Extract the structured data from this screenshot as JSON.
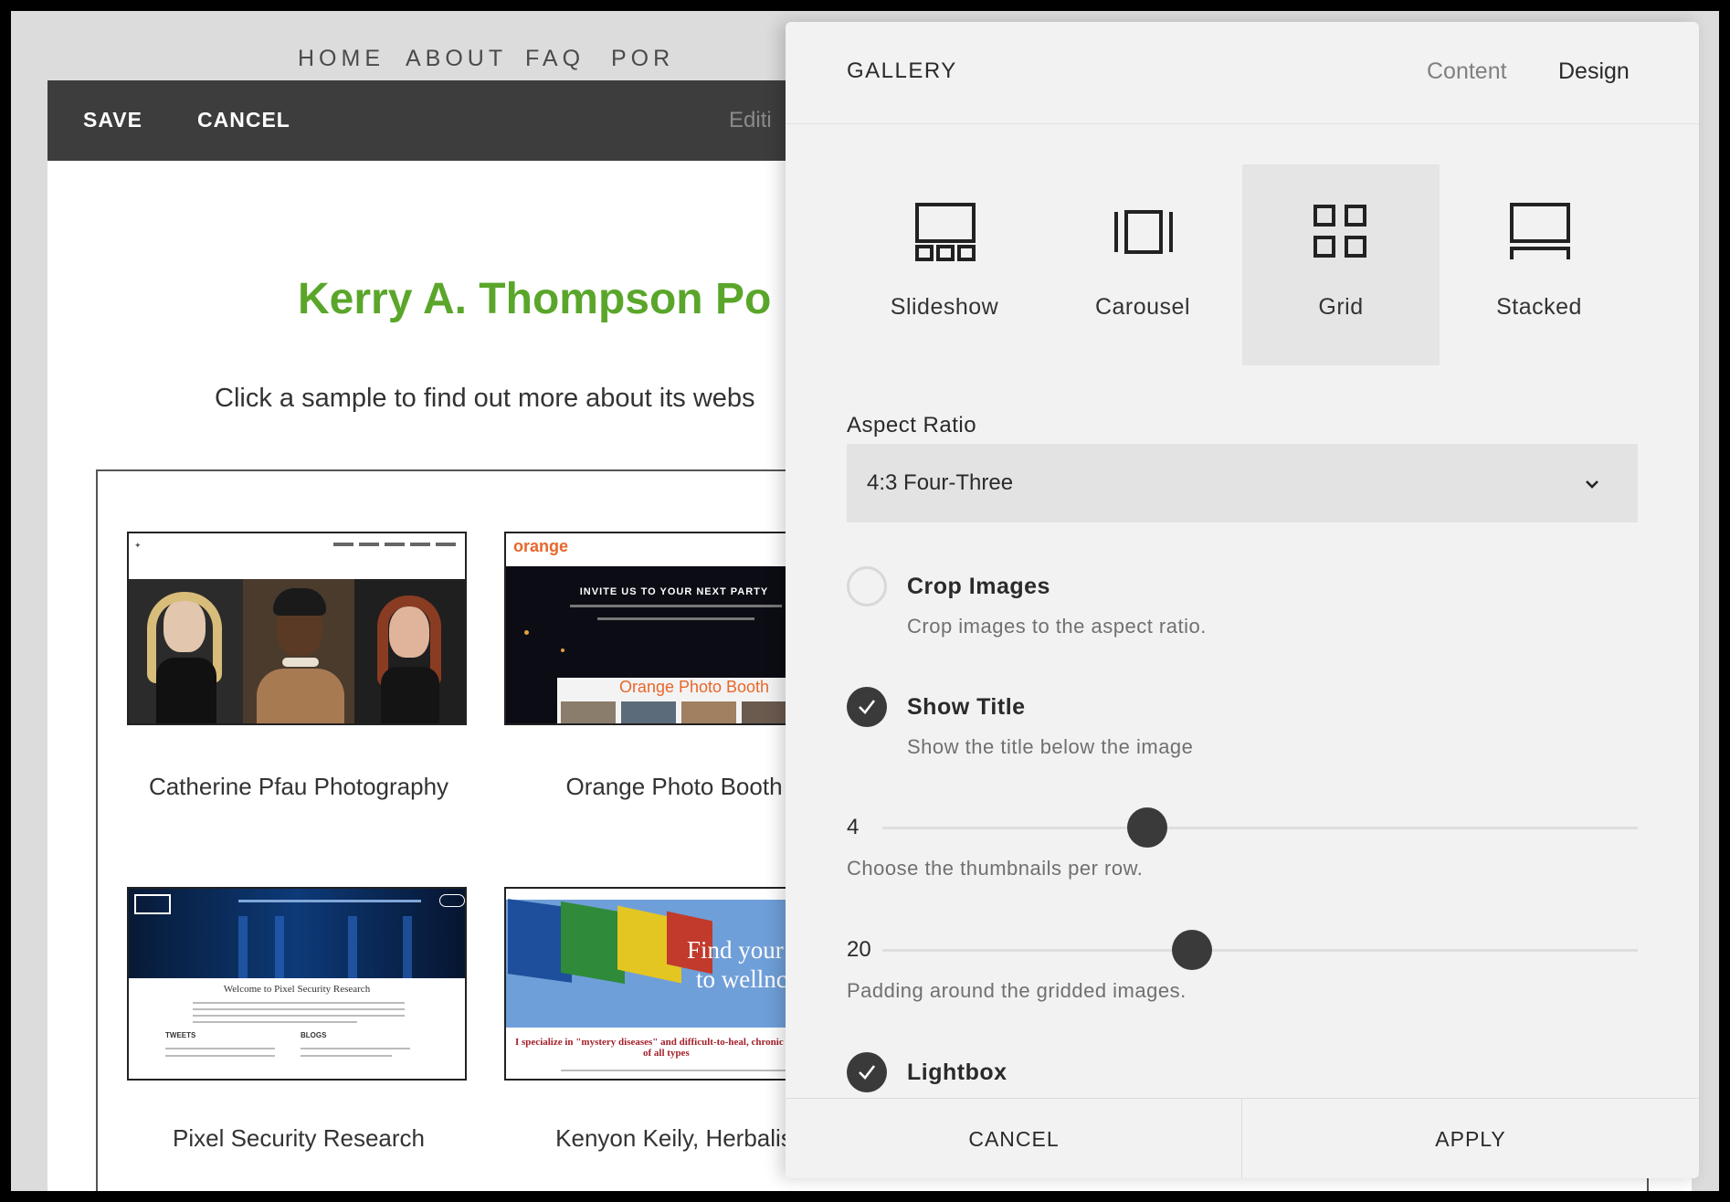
{
  "top_nav": [
    "HOME",
    "ABOUT",
    "FAQ",
    "POR"
  ],
  "edit_bar": {
    "save_label": "SAVE",
    "cancel_label": "CANCEL",
    "status_text": "Editi"
  },
  "page": {
    "title": "Kerry A. Thompson Po",
    "subtitle": "Click a sample to find out more about its webs"
  },
  "gallery_items": [
    {
      "caption": "Catherine Pfau Photography"
    },
    {
      "caption": "Orange Photo Booth",
      "thumb_text": [
        "INVITE US TO YOUR NEXT PARTY",
        "Orange Photo Booth",
        "orange"
      ]
    },
    {
      "caption": "Pixel Security Research",
      "thumb_text": [
        "Welcome to Pixel Security Research",
        "TWEETS",
        "BLOGS"
      ]
    },
    {
      "caption": "Kenyon Keily, Herbalis",
      "thumb_text": [
        "Find your",
        "to wellnc",
        "I specialize in \"mystery diseases\" and difficult-to-heal, chronic co",
        "of all types"
      ]
    }
  ],
  "panel": {
    "title": "GALLERY",
    "tabs": {
      "content": "Content",
      "design": "Design"
    },
    "layouts": [
      {
        "label": "Slideshow",
        "icon": "slideshow-icon",
        "selected": false
      },
      {
        "label": "Carousel",
        "icon": "carousel-icon",
        "selected": false
      },
      {
        "label": "Grid",
        "icon": "grid-icon",
        "selected": true
      },
      {
        "label": "Stacked",
        "icon": "stacked-icon",
        "selected": false
      }
    ],
    "aspect_ratio": {
      "label": "Aspect Ratio",
      "value": "4:3 Four-Three"
    },
    "crop_images": {
      "label": "Crop Images",
      "description": "Crop images to the aspect ratio.",
      "checked": false
    },
    "show_title": {
      "label": "Show Title",
      "description": "Show the title below the image",
      "checked": true
    },
    "thumbnails_per_row": {
      "value": "4",
      "description": "Choose the thumbnails per row."
    },
    "padding": {
      "value": "20",
      "description": "Padding around the gridded images."
    },
    "lightbox": {
      "label": "Lightbox",
      "checked": true
    },
    "footer": {
      "cancel_label": "CANCEL",
      "apply_label": "APPLY"
    }
  },
  "colors": {
    "title_green": "#5aa62a",
    "edit_bar": "#3d3d3d",
    "panel_bg": "#f2f2f2",
    "check_dark": "#3a3a3a"
  }
}
